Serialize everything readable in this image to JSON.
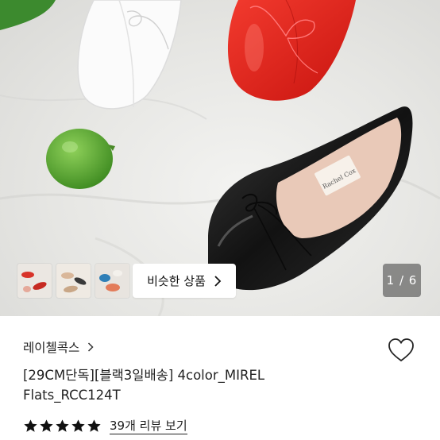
{
  "gallery": {
    "similar_button_label": "비슷한 상품",
    "page_indicator": "1 / 6",
    "thumbnails": [
      "red-flats-thumbnail",
      "beige-flats-thumbnail",
      "multi-color-flats-thumbnail"
    ],
    "insole_brand_text": "Rachel Cox"
  },
  "product": {
    "brand": "레이첼콕스",
    "title_line1": "[29CM단독][블랙3일배송] 4color_MIREL",
    "title_line2": "Flats_RCC124T",
    "rating": 5,
    "review_link": "39개 리뷰 보기"
  },
  "colors": {
    "star": "#111111",
    "text": "#222222",
    "red_shoe": "#e0221c",
    "black_shoe": "#1a1a1a",
    "lime": "#5aa832"
  }
}
